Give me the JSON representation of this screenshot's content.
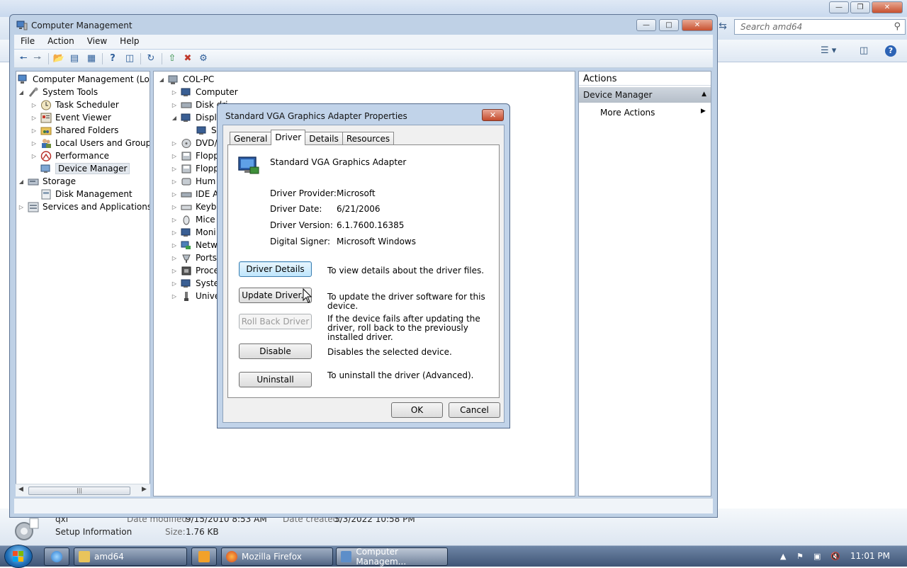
{
  "explorer": {
    "search_placeholder": "Search amd64",
    "details": {
      "file_name": "qxl",
      "file_type": "Setup Information",
      "date_modified_label": "Date modified:",
      "date_modified": "9/15/2010 8:53 AM",
      "date_created_label": "Date created:",
      "date_created": "5/3/2022 10:58 PM",
      "size_label": "Size:",
      "size": "1.76 KB"
    }
  },
  "cm": {
    "title": "Computer Management",
    "menu": [
      "File",
      "Action",
      "View",
      "Help"
    ],
    "tree": {
      "root": "Computer Management (Local)",
      "system_tools": "System Tools",
      "task_scheduler": "Task Scheduler",
      "event_viewer": "Event Viewer",
      "shared_folders": "Shared Folders",
      "local_users": "Local Users and Groups",
      "performance": "Performance",
      "device_manager": "Device Manager",
      "storage": "Storage",
      "disk_management": "Disk Management",
      "services": "Services and Applications"
    },
    "devices": {
      "root": "COL-PC",
      "items": [
        "Computer",
        "Disk dri",
        "Displa",
        "St",
        "DVD/",
        "Flopp",
        "Flopp",
        "Hum",
        "IDE A",
        "Keyb",
        "Mice",
        "Moni",
        "Netw",
        "Ports",
        "Proce",
        "Syste",
        "Unive"
      ]
    },
    "actions": {
      "header": "Actions",
      "section": "Device Manager",
      "more": "More Actions"
    }
  },
  "dialog": {
    "title": "Standard VGA Graphics Adapter Properties",
    "tabs": [
      "General",
      "Driver",
      "Details",
      "Resources"
    ],
    "device_name": "Standard VGA Graphics Adapter",
    "fields": {
      "provider_label": "Driver Provider:",
      "provider": "Microsoft",
      "date_label": "Driver Date:",
      "date": "6/21/2006",
      "version_label": "Driver Version:",
      "version": "6.1.7600.16385",
      "signer_label": "Digital Signer:",
      "signer": "Microsoft Windows"
    },
    "buttons": {
      "details": "Driver Details",
      "details_desc": "To view details about the driver files.",
      "update": "Update Driver...",
      "update_desc": "To update the driver software for this device.",
      "rollback": "Roll Back Driver",
      "rollback_desc": "If the device fails after updating the driver, roll back to the previously installed driver.",
      "disable": "Disable",
      "disable_desc": "Disables the selected device.",
      "uninstall": "Uninstall",
      "uninstall_desc": "To uninstall the driver (Advanced).",
      "ok": "OK",
      "cancel": "Cancel"
    }
  },
  "taskbar": {
    "items": [
      "amd64",
      "Mozilla Firefox",
      "Computer Managem..."
    ],
    "clock": "11:01 PM"
  }
}
